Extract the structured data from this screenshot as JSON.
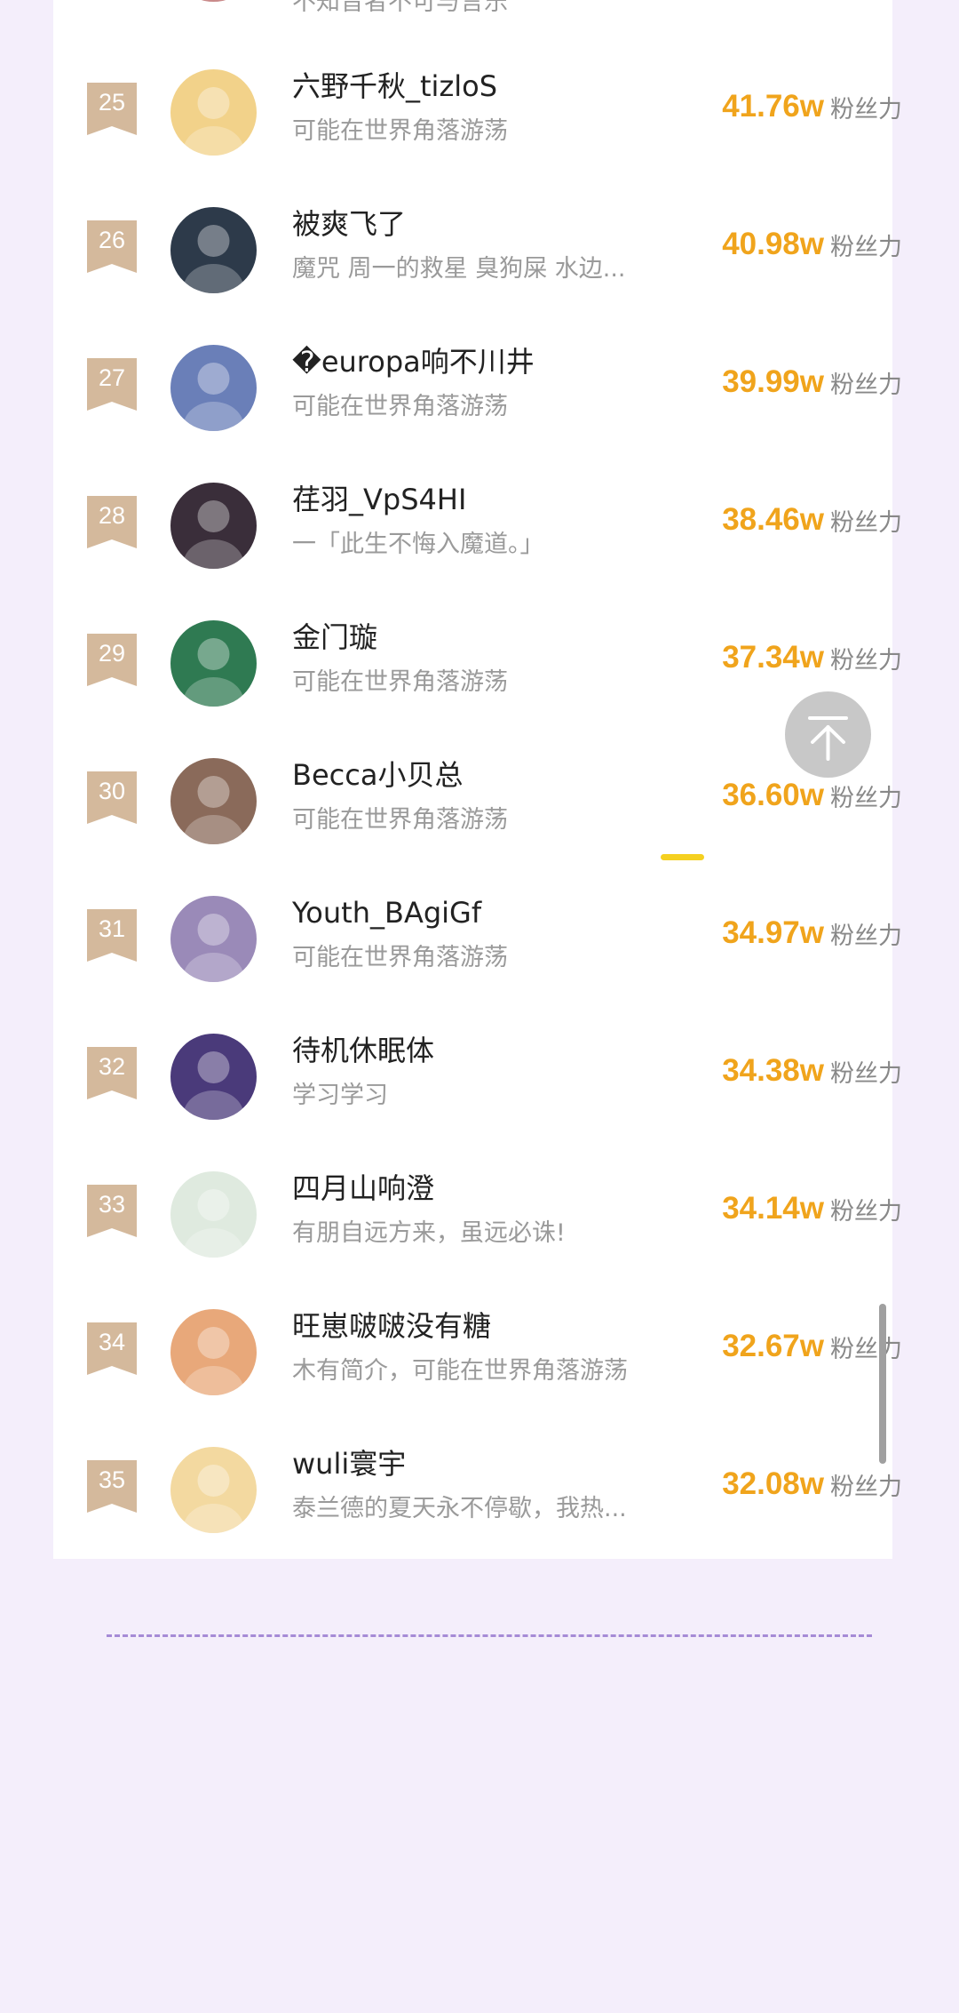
{
  "colors": {
    "background": "#f4eefb",
    "card": "#ffffff",
    "badge": "#d4b99c",
    "score": "#f0a41c",
    "divider": "#a68bd6"
  },
  "partial_top_row": {
    "bio": "不知音者不可与言乐"
  },
  "ranking": {
    "unit_label": "粉丝力",
    "rows": [
      {
        "rank": "25",
        "name": "六野千秋_tizloS",
        "bio": "可能在世界角落游荡",
        "score": "41.76w",
        "avatar_color": "#f2d28a"
      },
      {
        "rank": "26",
        "name": "被爽飞了",
        "bio": "魔咒 周一的救星 臭狗屎 水边...",
        "score": "40.98w",
        "avatar_color": "#2d3a4a"
      },
      {
        "rank": "27",
        "name": "�europa响不川井",
        "bio": "可能在世界角落游荡",
        "score": "39.99w",
        "avatar_color": "#6a7fb8"
      },
      {
        "rank": "28",
        "name": "荏羽_VpS4HI",
        "bio": "一「此生不悔入魔道。」",
        "score": "38.46w",
        "avatar_color": "#3a2e3a"
      },
      {
        "rank": "29",
        "name": "金门璇",
        "bio": "可能在世界角落游荡",
        "score": "37.34w",
        "avatar_color": "#2f7a52"
      },
      {
        "rank": "30",
        "name": "Becca小贝总",
        "bio": "可能在世界角落游荡",
        "score": "36.60w",
        "avatar_color": "#8a6a5a"
      },
      {
        "rank": "31",
        "name": "Youth_BAgiGf",
        "bio": "可能在世界角落游荡",
        "score": "34.97w",
        "avatar_color": "#9a8ab8"
      },
      {
        "rank": "32",
        "name": "待机休眠体",
        "bio": "学习学习",
        "score": "34.38w",
        "avatar_color": "#4a3a7a"
      },
      {
        "rank": "33",
        "name": "四月山响澄",
        "bio": "有朋自远方来，虽远必诛!",
        "score": "34.14w",
        "avatar_color": "#dfeadf"
      },
      {
        "rank": "34",
        "name": "旺崽啵啵没有糖",
        "bio": "木有简介，可能在世界角落游荡",
        "score": "32.67w",
        "avatar_color": "#e8a87a"
      },
      {
        "rank": "35",
        "name": "wuli寰宇",
        "bio": "泰兰德的夏天永不停歇，我热...",
        "score": "32.08w",
        "avatar_color": "#f3d9a0"
      }
    ]
  }
}
